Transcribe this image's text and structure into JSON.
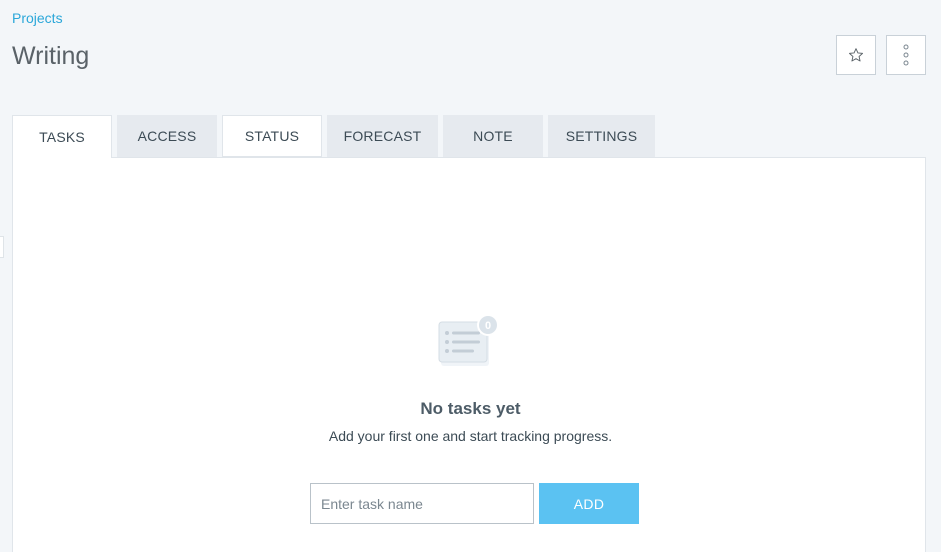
{
  "breadcrumb": {
    "label": "Projects"
  },
  "page": {
    "title": "Writing"
  },
  "header_actions": {
    "star_icon": "star-icon",
    "more_icon": "vertical-dots-icon"
  },
  "tabs": [
    {
      "label": "TASKS",
      "state": "active"
    },
    {
      "label": "ACCESS",
      "state": "inactive"
    },
    {
      "label": "STATUS",
      "state": "inactive-white"
    },
    {
      "label": "FORECAST",
      "state": "inactive"
    },
    {
      "label": "NOTE",
      "state": "inactive"
    },
    {
      "label": "SETTINGS",
      "state": "inactive"
    }
  ],
  "empty_state": {
    "badge_count": "0",
    "title": "No tasks yet",
    "subtitle": "Add your first one and start tracking progress."
  },
  "task_form": {
    "input_placeholder": "Enter task name",
    "input_value": "",
    "add_label": "ADD"
  },
  "colors": {
    "accent": "#2ba7d9",
    "add_button": "#5bc2f2",
    "background": "#f3f6f9",
    "tab_inactive": "#e6eaef"
  }
}
